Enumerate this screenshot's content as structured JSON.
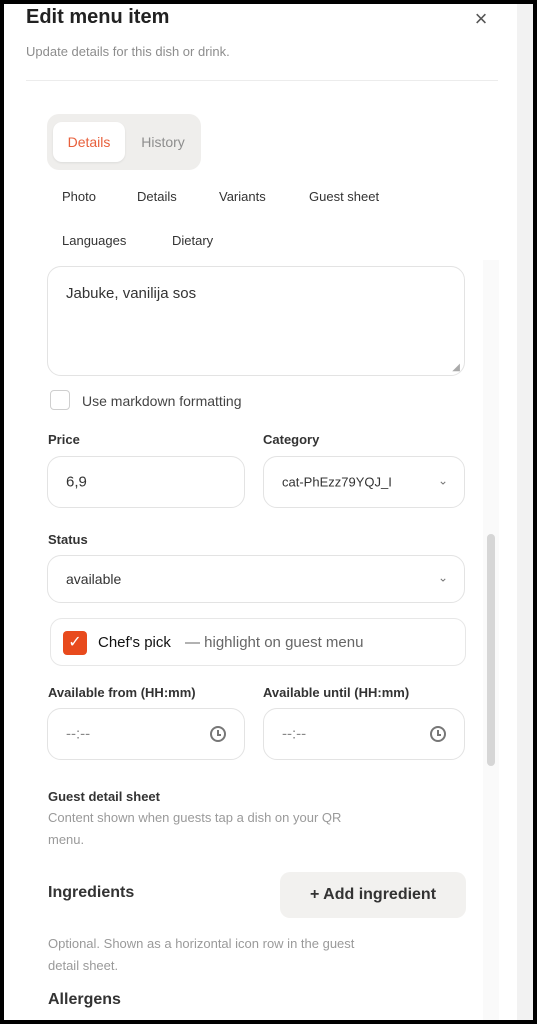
{
  "header": {
    "title": "Edit menu item",
    "subtitle": "Update details for this dish or drink.",
    "close_glyph": "×"
  },
  "segmented": {
    "details": "Details",
    "history": "History"
  },
  "subtabs": [
    "Photo",
    "Details",
    "Variants",
    "Guest sheet",
    "Languages",
    "Dietary"
  ],
  "description": {
    "value": "Jabuke, vanilija sos"
  },
  "markdown": {
    "label": "Use markdown formatting",
    "checked": false
  },
  "price": {
    "label": "Price",
    "value": "6,9"
  },
  "category": {
    "label": "Category",
    "value": "cat-PhEzz79YQJ_I"
  },
  "status": {
    "label": "Status",
    "value": "available"
  },
  "chefs_pick": {
    "title": "Chef's pick",
    "subtitle": "— highlight on guest menu",
    "checked": true
  },
  "available_from": {
    "label": "Available from (HH:mm)",
    "value": "--:--"
  },
  "available_until": {
    "label": "Available until (HH:mm)",
    "value": "--:--"
  },
  "guest_sheet": {
    "title": "Guest detail sheet",
    "desc_line1": "Content shown when guests tap a dish on your QR",
    "desc_line2": "menu."
  },
  "ingredients": {
    "title": "Ingredients",
    "add_label": "+  Add ingredient",
    "help_line1": "Optional. Shown as a horizontal icon row in the guest",
    "help_line2": "detail sheet."
  },
  "allergens": {
    "title": "Allergens"
  },
  "icons": {
    "close": "close-icon",
    "chevron": "chevron-down-icon",
    "clock": "clock-icon",
    "check": "check-icon",
    "resize": "resize-icon"
  },
  "colors": {
    "accent": "#e84a1d",
    "active_tab": "#e8603c"
  }
}
